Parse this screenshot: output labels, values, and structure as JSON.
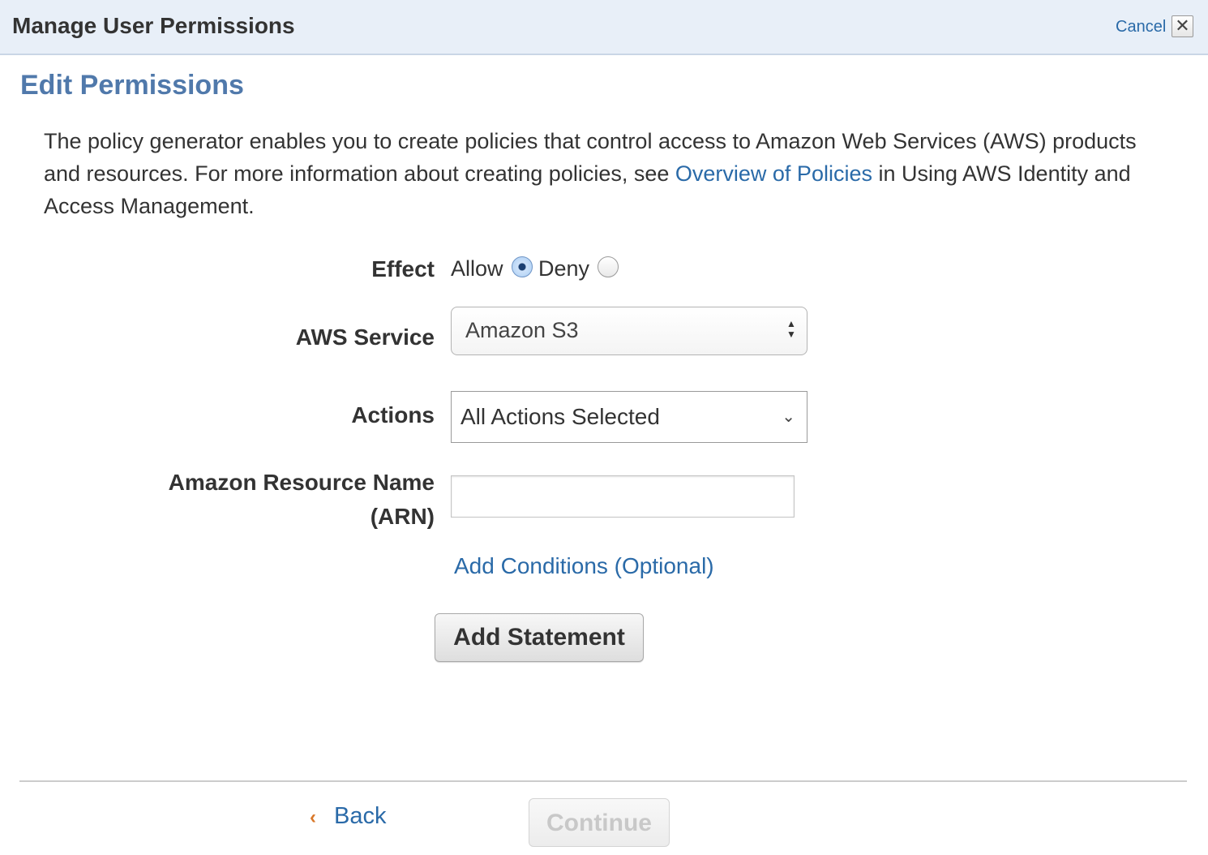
{
  "header": {
    "title": "Manage User Permissions",
    "cancel_label": "Cancel",
    "close_glyph": "✕"
  },
  "page": {
    "title": "Edit Permissions",
    "intro_before_link": "The policy generator enables you to create policies that control access to Amazon Web Services (AWS) products and resources. For more information about creating policies, see ",
    "intro_link": "Overview of Policies",
    "intro_after_link": " in Using AWS Identity and Access Management."
  },
  "form": {
    "effect": {
      "label": "Effect",
      "options": [
        {
          "label": "Allow",
          "checked": true
        },
        {
          "label": "Deny",
          "checked": false
        }
      ]
    },
    "service": {
      "label": "AWS Service",
      "value": "Amazon S3"
    },
    "actions": {
      "label": "Actions",
      "value": "All Actions Selected"
    },
    "arn": {
      "label_line1": "Amazon Resource Name",
      "label_line2": "(ARN)",
      "value": ""
    },
    "add_conditions_label": "Add Conditions (Optional)",
    "add_statement_label": "Add Statement"
  },
  "footer": {
    "back_label": "Back",
    "continue_label": "Continue",
    "continue_enabled": false
  },
  "colors": {
    "link": "#2a6aa8",
    "title_blue": "#5079ab",
    "header_bg": "#e8eff8",
    "back_arrow": "#d9782a"
  },
  "icons": {
    "close": "close-icon",
    "select_arrows": "up-down-arrows-icon",
    "dropdown": "chevron-down-icon",
    "back": "chevron-left-icon"
  }
}
